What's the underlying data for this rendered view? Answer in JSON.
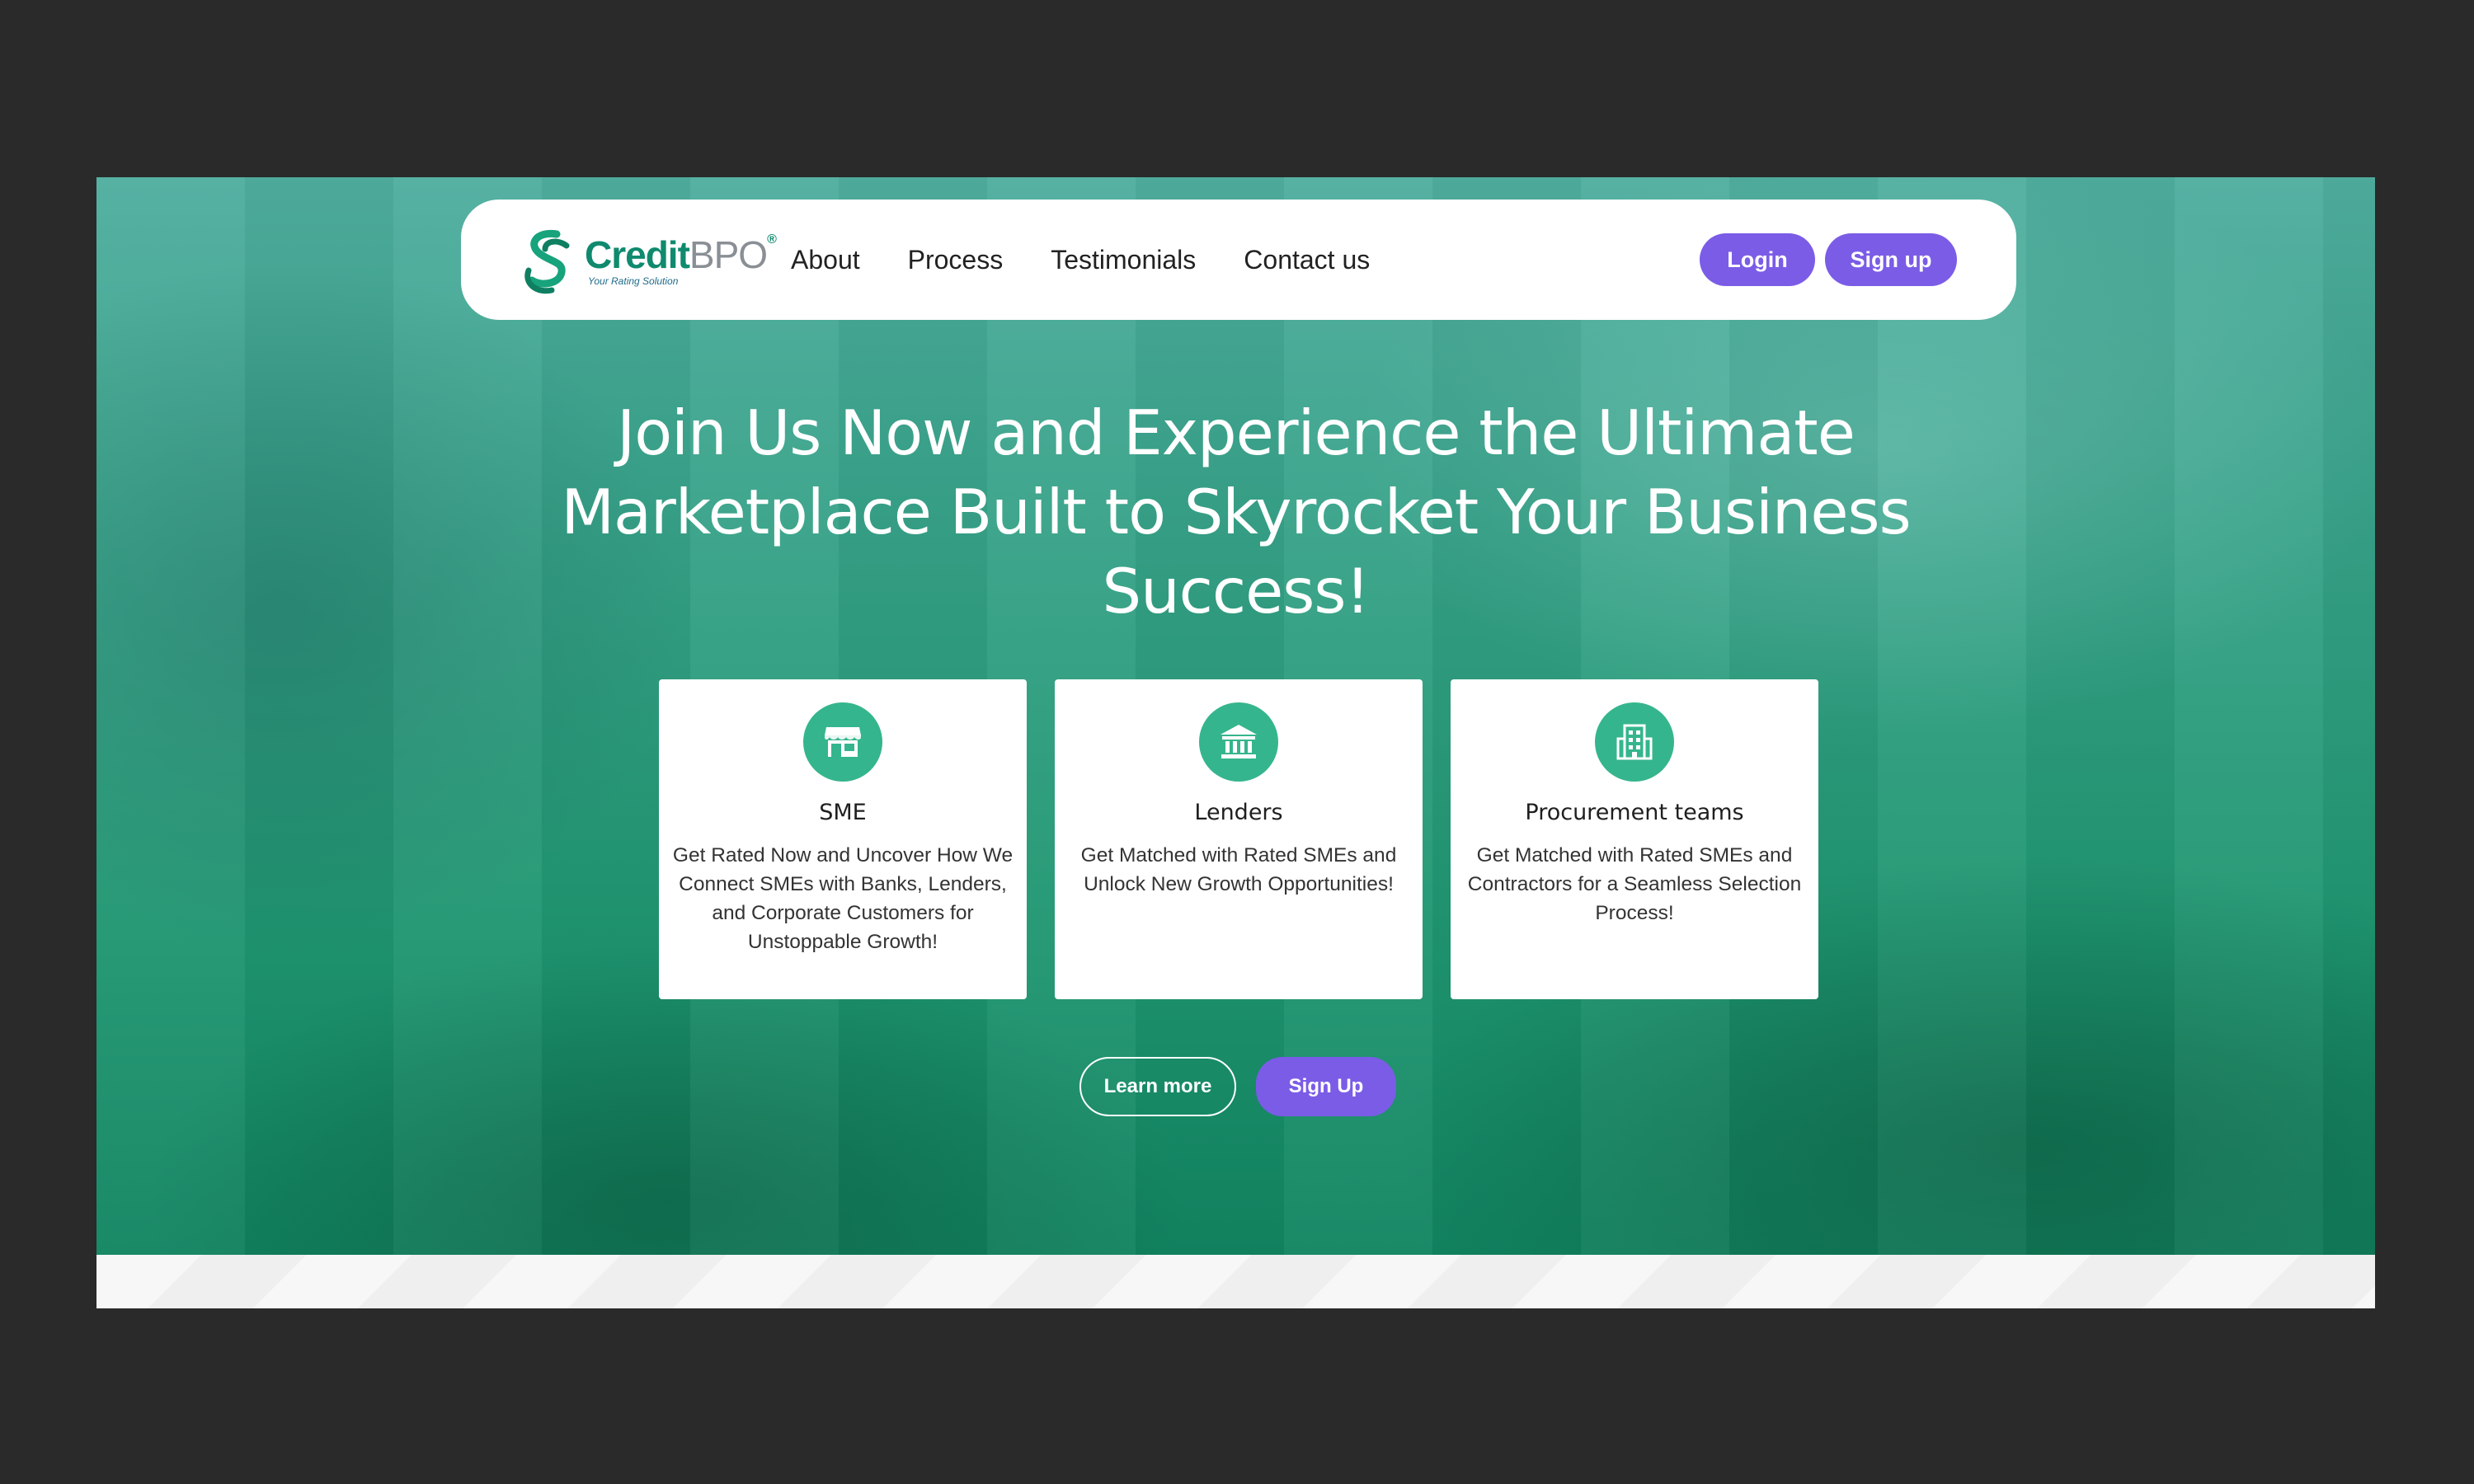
{
  "brand": {
    "name_part1": "Credit",
    "name_part2": "BPO",
    "registered": "®",
    "tagline": "Your Rating Solution"
  },
  "nav": {
    "links": [
      "About",
      "Process",
      "Testimonials",
      "Contact us"
    ],
    "login_label": "Login",
    "signup_label": "Sign up"
  },
  "hero": {
    "headline_lines": [
      "Join Us Now and Experience the Ultimate",
      "Marketplace Built to Skyrocket Your Business",
      "Success!"
    ],
    "cards": [
      {
        "icon": "storefront-icon",
        "title": "SME",
        "description": "Get Rated Now and Uncover How We Connect SMEs with Banks, Lenders, and Corporate Customers for Unstoppable Growth!"
      },
      {
        "icon": "bank-icon",
        "title": "Lenders",
        "description": "Get Matched with Rated SMEs and Unlock New Growth Opportunities!"
      },
      {
        "icon": "building-icon",
        "title": "Procurement teams",
        "description": "Get Matched with Rated SMEs and Contractors for a Seamless Selection Process!"
      }
    ],
    "learn_more_label": "Learn more",
    "signup_label": "Sign Up"
  },
  "colors": {
    "accent_purple": "#7b5ce6",
    "brand_green": "#0f8a6e",
    "icon_circle": "#35b58d",
    "hero_top": "#4fae9f",
    "hero_bottom": "#118460",
    "outer_background": "#2a2a2a"
  }
}
